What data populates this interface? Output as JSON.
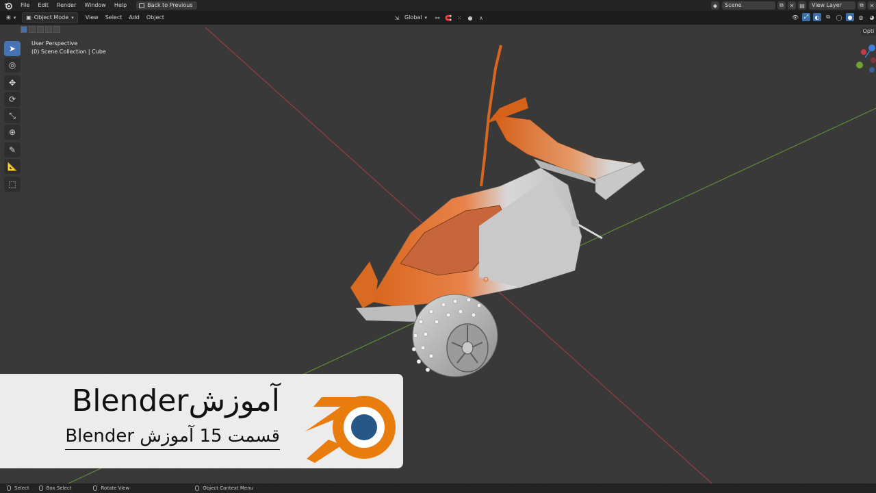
{
  "menu": {
    "items": [
      "File",
      "Edit",
      "Render",
      "Window",
      "Help"
    ],
    "back_label": "Back to Previous"
  },
  "top_right": {
    "scene_label": "Scene",
    "view_layer_label": "View Layer"
  },
  "header": {
    "mode_label": "Object Mode",
    "menu_items": [
      "View",
      "Select",
      "Add",
      "Object"
    ],
    "orientation_label": "Global",
    "options_label": "Opti"
  },
  "viewport": {
    "perspective_label": "User Perspective",
    "collection_label": "(0) Scene Collection | Cube"
  },
  "banner": {
    "title": "آموزشBlender",
    "subtitle": "قسمت 15 آموزش Blender"
  },
  "status": {
    "select": "Select",
    "box_select": "Box Select",
    "rotate_view": "Rotate View",
    "context_menu": "Object Context Menu"
  },
  "colors": {
    "accent": "#4772b3",
    "blender_orange": "#e87d0d",
    "blender_blue": "#265787",
    "x_axis": "#c8333e",
    "y_axis": "#6da230"
  }
}
